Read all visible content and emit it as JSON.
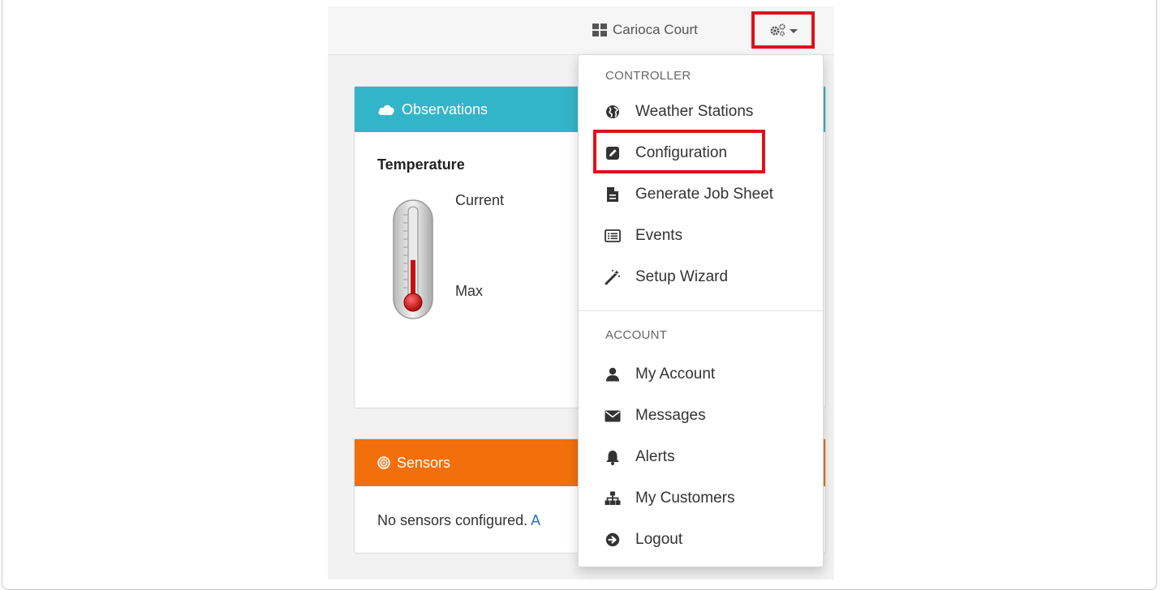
{
  "navbar": {
    "brand_label": "Carioca Court",
    "settings_icon": "gears-icon"
  },
  "observations": {
    "title": "Observations",
    "temperature_title": "Temperature",
    "current_label": "Current",
    "max_label": "Max"
  },
  "sensors": {
    "title": "Sensors",
    "empty_text": "No sensors configured.",
    "link_fragment": "A"
  },
  "menu": {
    "controller_header": "CONTROLLER",
    "controller_items": [
      {
        "label": "Weather Stations",
        "icon": "globe-icon"
      },
      {
        "label": "Configuration",
        "icon": "edit-icon"
      },
      {
        "label": "Generate Job Sheet",
        "icon": "file-icon"
      },
      {
        "label": "Events",
        "icon": "list-icon"
      },
      {
        "label": "Setup Wizard",
        "icon": "magic-wand-icon"
      }
    ],
    "account_header": "ACCOUNT",
    "account_items": [
      {
        "label": "My Account",
        "icon": "user-icon"
      },
      {
        "label": "Messages",
        "icon": "envelope-icon"
      },
      {
        "label": "Alerts",
        "icon": "bell-icon"
      },
      {
        "label": "My Customers",
        "icon": "sitemap-icon"
      },
      {
        "label": "Logout",
        "icon": "logout-icon"
      }
    ]
  },
  "colors": {
    "observations_header": "#33b5c9",
    "sensors_header": "#f36f0b",
    "highlight": "#e0101a",
    "link": "#2a6ebb"
  },
  "thermometer": {
    "fill_level": 0.45
  }
}
